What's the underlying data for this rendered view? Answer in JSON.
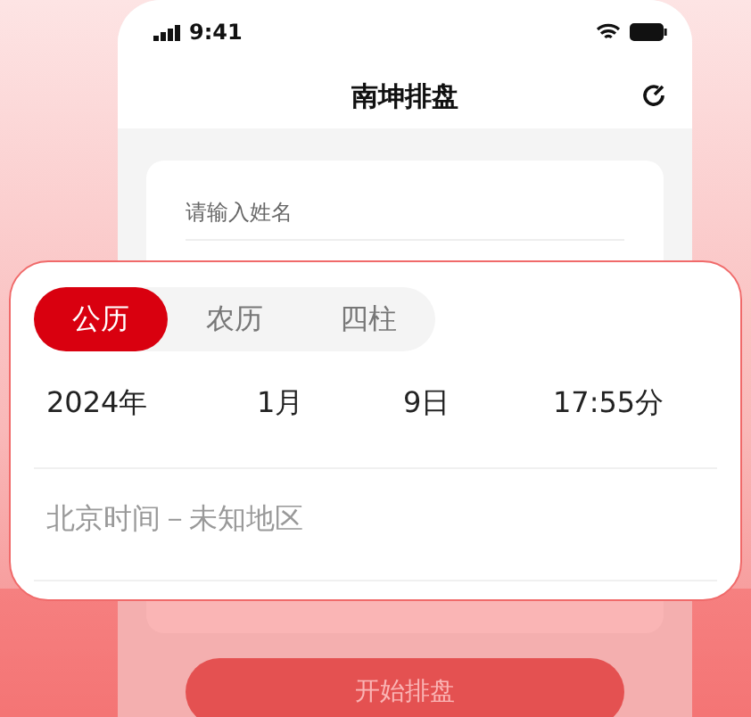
{
  "status_bar": {
    "time": "9:41"
  },
  "title": "南坤排盘",
  "form": {
    "name_placeholder": "请输入姓名",
    "submit": "开始排盘"
  },
  "picker": {
    "tabs": [
      {
        "label": "公历",
        "selected": true
      },
      {
        "label": "农历",
        "selected": false
      },
      {
        "label": "四柱",
        "selected": false
      }
    ],
    "date": [
      "2024年",
      "1月",
      "9日",
      "17:55分"
    ],
    "location": "北京时间－未知地区"
  }
}
